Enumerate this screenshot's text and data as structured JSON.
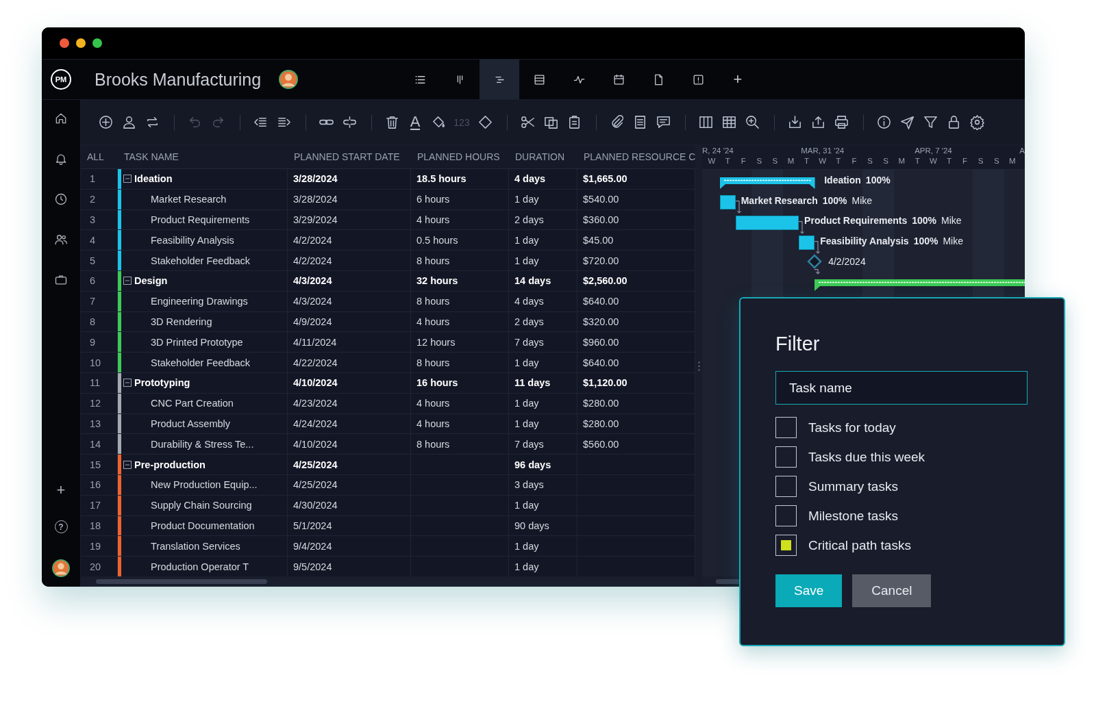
{
  "window": {
    "title": "Brooks Manufacturing",
    "logo": "PM"
  },
  "view_tabs": [
    {
      "kind": "list",
      "selected": false
    },
    {
      "kind": "board",
      "selected": false
    },
    {
      "kind": "gantt",
      "selected": true
    },
    {
      "kind": "sheet",
      "selected": false
    },
    {
      "kind": "pulse",
      "selected": false
    },
    {
      "kind": "calendar",
      "selected": false
    },
    {
      "kind": "doc",
      "selected": false
    },
    {
      "kind": "alert",
      "selected": false
    }
  ],
  "add_view": "+",
  "sidebar": {
    "items": [
      {
        "kind": "home"
      },
      {
        "kind": "bell"
      },
      {
        "kind": "clock"
      },
      {
        "kind": "people"
      },
      {
        "kind": "briefcase"
      }
    ],
    "add": "+",
    "help": "?"
  },
  "toolbar": [
    [
      {
        "kind": "add",
        "disabled": false
      },
      {
        "kind": "user",
        "disabled": false
      },
      {
        "kind": "repeat",
        "disabled": false
      }
    ],
    [
      {
        "kind": "undo",
        "disabled": true
      },
      {
        "kind": "redo",
        "disabled": true
      }
    ],
    [
      {
        "kind": "outdent",
        "disabled": false
      },
      {
        "kind": "indent",
        "disabled": false
      }
    ],
    [
      {
        "kind": "link",
        "disabled": false
      },
      {
        "kind": "unlink",
        "disabled": false
      }
    ],
    [
      {
        "kind": "trash",
        "disabled": false
      },
      {
        "kind": "font-color",
        "text": "A",
        "disabled": false
      },
      {
        "kind": "bucket",
        "disabled": false
      },
      {
        "kind": "number-format",
        "text": "123",
        "disabled": true
      },
      {
        "kind": "diamond",
        "disabled": false
      }
    ],
    [
      {
        "kind": "scissors",
        "disabled": false
      },
      {
        "kind": "copy",
        "disabled": false
      },
      {
        "kind": "paste",
        "disabled": false
      }
    ],
    [
      {
        "kind": "clip",
        "disabled": false
      },
      {
        "kind": "notes",
        "disabled": false
      },
      {
        "kind": "comment",
        "disabled": false
      }
    ],
    [
      {
        "kind": "columns",
        "disabled": false
      },
      {
        "kind": "grid",
        "disabled": false
      },
      {
        "kind": "zoom",
        "disabled": false
      }
    ],
    [
      {
        "kind": "import",
        "disabled": false
      },
      {
        "kind": "export",
        "disabled": false
      },
      {
        "kind": "print",
        "disabled": false
      }
    ],
    [
      {
        "kind": "info",
        "disabled": false
      },
      {
        "kind": "send",
        "disabled": false
      },
      {
        "kind": "filter",
        "disabled": false
      },
      {
        "kind": "lock",
        "disabled": false
      },
      {
        "kind": "gear",
        "disabled": false
      }
    ]
  ],
  "table": {
    "columns": [
      "ALL",
      "TASK NAME",
      "PLANNED START DATE",
      "PLANNED HOURS",
      "DURATION",
      "PLANNED RESOURCE C"
    ],
    "groups": [
      {
        "number": "1",
        "name": "Ideation",
        "start": "3/28/2024",
        "hours": "18.5 hours",
        "duration": "4 days",
        "cost": "$1,665.00",
        "color": "#1cc3e8",
        "expanded": true,
        "children": [
          {
            "number": "2",
            "name": "Market Research",
            "start": "3/28/2024",
            "hours": "6 hours",
            "duration": "1 day",
            "cost": "$540.00"
          },
          {
            "number": "3",
            "name": "Product Requirements",
            "start": "3/29/2024",
            "hours": "4 hours",
            "duration": "2 days",
            "cost": "$360.00"
          },
          {
            "number": "4",
            "name": "Feasibility Analysis",
            "start": "4/2/2024",
            "hours": "0.5 hours",
            "duration": "1 day",
            "cost": "$45.00"
          },
          {
            "number": "5",
            "name": "Stakeholder Feedback",
            "start": "4/2/2024",
            "hours": "8 hours",
            "duration": "1 day",
            "cost": "$720.00"
          }
        ]
      },
      {
        "number": "6",
        "name": "Design",
        "start": "4/3/2024",
        "hours": "32 hours",
        "duration": "14 days",
        "cost": "$2,560.00",
        "color": "#3dcb55",
        "expanded": true,
        "children": [
          {
            "number": "7",
            "name": "Engineering Drawings",
            "start": "4/3/2024",
            "hours": "8 hours",
            "duration": "4 days",
            "cost": "$640.00"
          },
          {
            "number": "8",
            "name": "3D Rendering",
            "start": "4/9/2024",
            "hours": "4 hours",
            "duration": "2 days",
            "cost": "$320.00"
          },
          {
            "number": "9",
            "name": "3D Printed Prototype",
            "start": "4/11/2024",
            "hours": "12 hours",
            "duration": "7 days",
            "cost": "$960.00"
          },
          {
            "number": "10",
            "name": "Stakeholder Feedback",
            "start": "4/22/2024",
            "hours": "8 hours",
            "duration": "1 day",
            "cost": "$640.00"
          }
        ]
      },
      {
        "number": "11",
        "name": "Prototyping",
        "start": "4/10/2024",
        "hours": "16 hours",
        "duration": "11 days",
        "cost": "$1,120.00",
        "color": "#a6a9b2",
        "expanded": true,
        "children": [
          {
            "number": "12",
            "name": "CNC Part Creation",
            "start": "4/23/2024",
            "hours": "4 hours",
            "duration": "1 day",
            "cost": "$280.00"
          },
          {
            "number": "13",
            "name": "Product Assembly",
            "start": "4/24/2024",
            "hours": "4 hours",
            "duration": "1 day",
            "cost": "$280.00"
          },
          {
            "number": "14",
            "name": "Durability & Stress Te...",
            "start": "4/10/2024",
            "hours": "8 hours",
            "duration": "7 days",
            "cost": "$560.00"
          }
        ]
      },
      {
        "number": "15",
        "name": "Pre-production",
        "start": "4/25/2024",
        "duration": "96 days",
        "color": "#f0622f",
        "expanded": true,
        "children": [
          {
            "number": "16",
            "name": "New Production Equip...",
            "start": "4/25/2024",
            "duration": "3 days"
          },
          {
            "number": "17",
            "name": "Supply Chain Sourcing",
            "start": "4/30/2024",
            "duration": "1 day"
          },
          {
            "number": "18",
            "name": "Product Documentation",
            "start": "5/1/2024",
            "duration": "90 days"
          },
          {
            "number": "19",
            "name": "Translation Services",
            "start": "9/4/2024",
            "duration": "1 day"
          },
          {
            "number": "20",
            "name": "Production Operator T",
            "start": "9/5/2024",
            "duration": "1 day"
          }
        ]
      }
    ]
  },
  "gantt": {
    "weeks": [
      "R, 24 '24",
      "MAR, 31 '24",
      "APR, 7 '24",
      "A"
    ],
    "days": [
      "W",
      "T",
      "F",
      "S",
      "S",
      "M",
      "T",
      "W",
      "T",
      "F",
      "S",
      "S",
      "M",
      "T",
      "W",
      "T",
      "F",
      "S",
      "S",
      "M"
    ],
    "bars": [
      {
        "kind": "summary",
        "name": "Ideation",
        "percent": "100%"
      },
      {
        "kind": "task",
        "name": "Market Research",
        "percent": "100%",
        "assignee": "Mike"
      },
      {
        "kind": "task",
        "name": "Product Requirements",
        "percent": "100%",
        "assignee": "Mike"
      },
      {
        "kind": "task",
        "name": "Feasibility Analysis",
        "percent": "100%",
        "assignee": "Mike"
      },
      {
        "kind": "milestone",
        "date": "4/2/2024"
      },
      {
        "kind": "summary"
      }
    ]
  },
  "filter_dialog": {
    "title": "Filter",
    "field": {
      "placeholder": "Task name"
    },
    "options": [
      {
        "label": "Tasks for today",
        "checked": false
      },
      {
        "label": "Tasks due this week",
        "checked": false
      },
      {
        "label": "Summary tasks",
        "checked": false
      },
      {
        "label": "Milestone tasks",
        "checked": false
      },
      {
        "label": "Critical path tasks",
        "checked": true
      }
    ],
    "buttons": [
      {
        "label": "Save",
        "kind": "primary"
      },
      {
        "label": "Cancel",
        "kind": "secondary"
      }
    ]
  }
}
